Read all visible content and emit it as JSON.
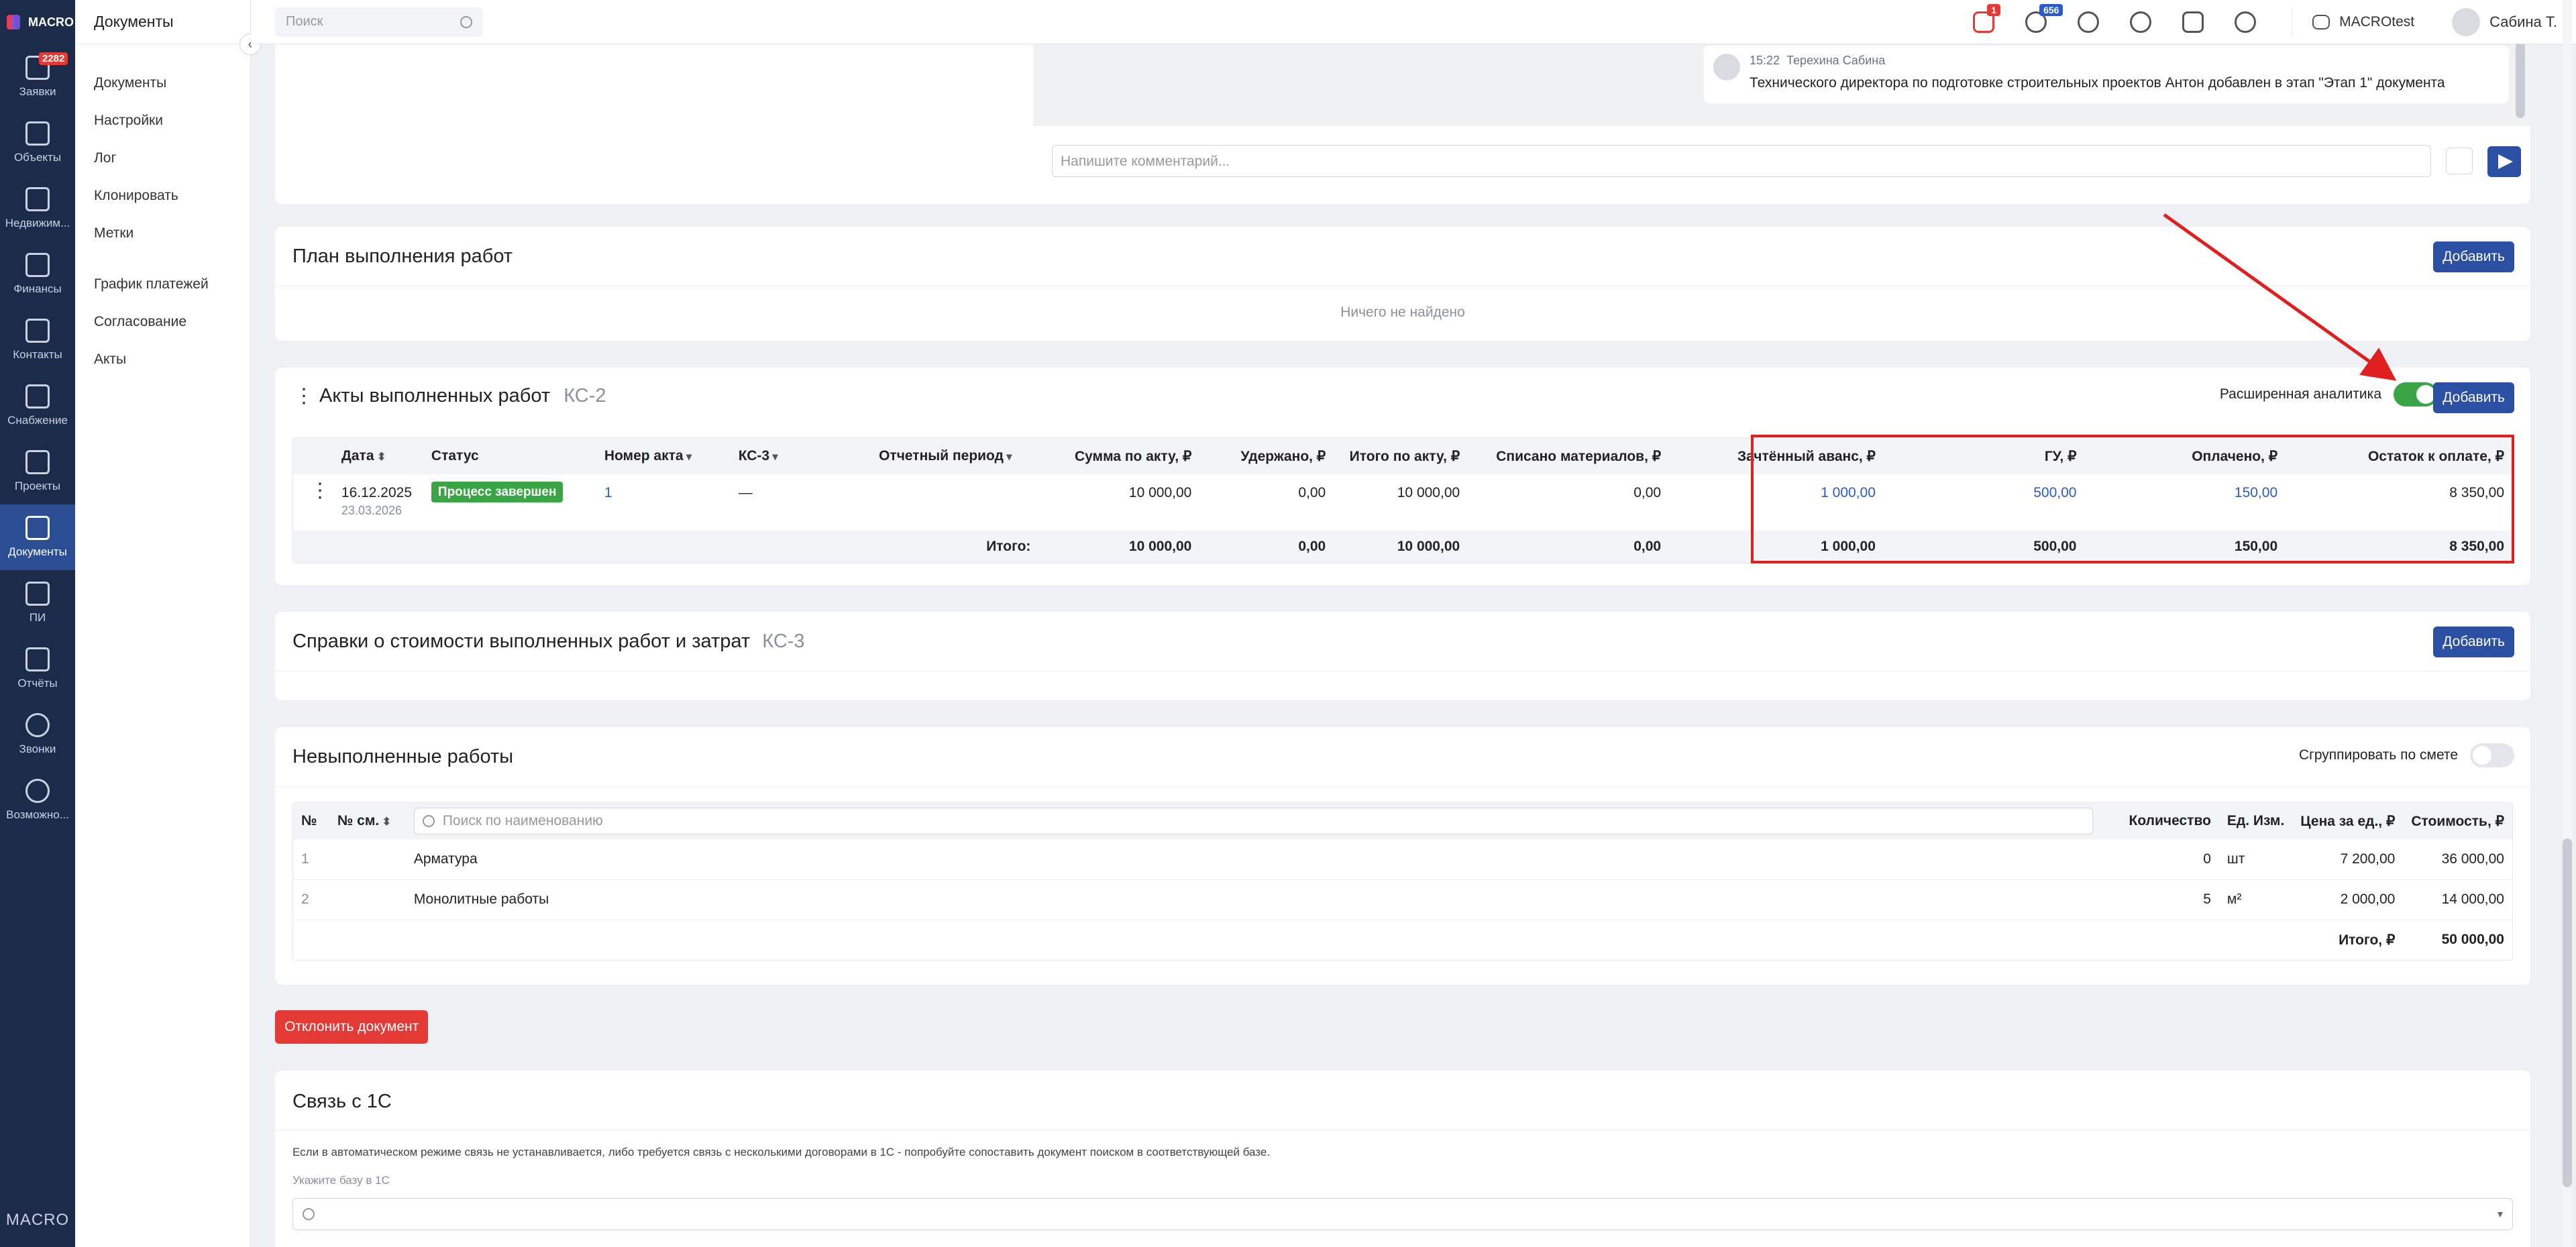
{
  "brand": {
    "name": "MACRO",
    "bottom": "MACRO"
  },
  "leftnav": [
    {
      "label": "Заявки",
      "icon": "requests-icon",
      "badge": "2282"
    },
    {
      "label": "Объекты",
      "icon": "cube-icon"
    },
    {
      "label": "Недвижим...",
      "icon": "building-icon"
    },
    {
      "label": "Финансы",
      "icon": "wallet-icon"
    },
    {
      "label": "Контакты",
      "icon": "contacts-icon"
    },
    {
      "label": "Снабжение",
      "icon": "truck-icon"
    },
    {
      "label": "Проекты",
      "icon": "projects-icon"
    },
    {
      "label": "Документы",
      "icon": "clipboard-icon",
      "active": true
    },
    {
      "label": "ПИ",
      "icon": "monitor-icon"
    },
    {
      "label": "Отчёты",
      "icon": "bar-chart-icon"
    },
    {
      "label": "Звонки",
      "icon": "phone-icon"
    },
    {
      "label": "Возможно...",
      "icon": "gear-icon"
    }
  ],
  "subnav": {
    "title": "Документы",
    "items": [
      "Документы",
      "Настройки",
      "Лог",
      "Клонировать",
      "Метки",
      "График платежей",
      "Согласование",
      "Акты"
    ]
  },
  "topbar": {
    "search_placeholder": "Поиск",
    "calendar_badge": "1",
    "notifications_badge": "656",
    "org": "MACROtest",
    "user": "Сабина Т."
  },
  "comments": {
    "time": "15:22",
    "author": "Терехина Сабина",
    "text": "Технического директора по подготовке строительных проектов Антон добавлен в этап \"Этап 1\" документа",
    "input_placeholder": "Напишите комментарий..."
  },
  "plan": {
    "title": "План выполнения работ",
    "add": "Добавить",
    "empty": "Ничего не найдено"
  },
  "acts": {
    "title": "Акты выполненных работ",
    "tag": "КС-2",
    "analytics_label": "Расширенная аналитика",
    "analytics_on": true,
    "add": "Добавить",
    "columns": [
      "Дата",
      "Статус",
      "Номер акта",
      "КС-3",
      "Отчетный период",
      "Сумма по акту, ₽",
      "Удержано, ₽",
      "Итого по акту, ₽",
      "Списано материалов, ₽",
      "Зачтённый аванс, ₽",
      "ГУ, ₽",
      "Оплачено, ₽",
      "Остаток к оплате, ₽"
    ],
    "row": {
      "date": "16.12.2025",
      "date2": "23.03.2026",
      "status": "Процесс завершен",
      "number": "1",
      "ks3": "—",
      "period": "",
      "sum": "10 000,00",
      "withheld": "0,00",
      "total": "10 000,00",
      "materials": "0,00",
      "advance": "1 000,00",
      "gu": "500,00",
      "paid": "150,00",
      "remaining": "8 350,00"
    },
    "totals": {
      "label": "Итого:",
      "sum": "10 000,00",
      "withheld": "0,00",
      "total": "10 000,00",
      "materials": "0,00",
      "advance": "1 000,00",
      "gu": "500,00",
      "paid": "150,00",
      "remaining": "8 350,00"
    }
  },
  "certs": {
    "title": "Справки о стоимости выполненных работ и затрат",
    "tag": "КС-3",
    "add": "Добавить"
  },
  "unfinished": {
    "title": "Невыполненные работы",
    "group_label": "Сгруппировать по смете",
    "group_on": false,
    "search_placeholder": "Поиск по наименованию",
    "columns": [
      "№",
      "№ см.",
      "Количество",
      "Ед. Изм.",
      "Цена за ед., ₽",
      "Стоимость, ₽"
    ],
    "rows": [
      {
        "n": "1",
        "name": "Арматура",
        "qty": "0",
        "unit": "шт",
        "price": "7 200,00",
        "cost": "36 000,00"
      },
      {
        "n": "2",
        "name": "Монолитные работы",
        "qty": "5",
        "unit": "м²",
        "price": "2 000,00",
        "cost": "14 000,00"
      }
    ],
    "total_label": "Итого, ₽",
    "total": "50 000,00"
  },
  "reject_button": "Отклонить документ",
  "onec": {
    "title": "Связь с 1С",
    "hint": "Если в автоматическом режиме связь не устанавливается, либо требуется связь с несколькими договорами в 1С - попробуйте сопоставить документ поиском в соответствующей базе.",
    "base_label": "Укажите базу в 1С"
  },
  "colors": {
    "accent": "#2b4fa3",
    "success": "#3aa544",
    "danger": "#e53935",
    "highlight": "#e01f1f"
  }
}
